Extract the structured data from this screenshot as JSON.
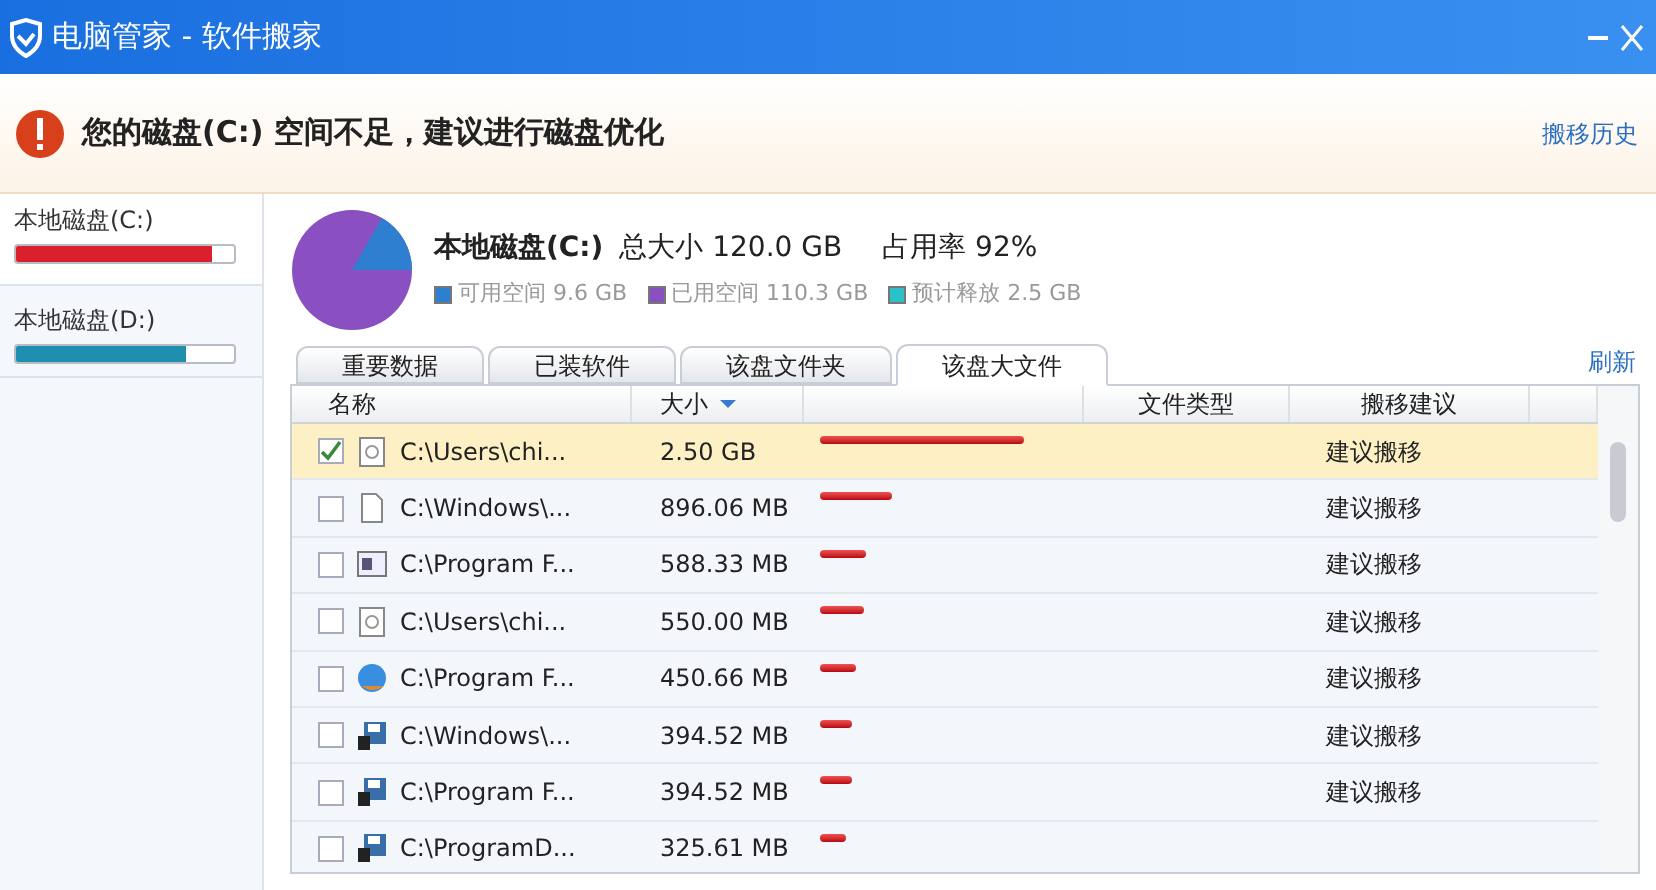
{
  "window": {
    "title": "电脑管家 - 软件搬家"
  },
  "alert": {
    "message": "您的磁盘(C:) 空间不足，建议进行磁盘优化",
    "link": "搬移历史"
  },
  "sidebar": {
    "items": [
      {
        "label": "本地磁盘(C:)",
        "level": 0.9,
        "selected": true,
        "color": "#d9202c"
      },
      {
        "label": "本地磁盘(D:)",
        "level": 0.78,
        "selected": false,
        "color": "#1f8fb0"
      }
    ]
  },
  "disk": {
    "name": "本地磁盘(C:)",
    "total": "总大小 120.0 GB",
    "usage": "占用率 92%",
    "legend": [
      {
        "label": "可用空间 9.6 GB",
        "color": "#2f7fd0"
      },
      {
        "label": "已用空间 110.3 GB",
        "color": "#8a4fc0"
      },
      {
        "label": "预计释放 2.5 GB",
        "color": "#2cc0c8"
      }
    ]
  },
  "tabs": [
    {
      "label": "重要数据",
      "selected": false
    },
    {
      "label": "已装软件",
      "selected": false
    },
    {
      "label": "该盘文件夹",
      "selected": false
    },
    {
      "label": "该盘大文件",
      "selected": true
    }
  ],
  "refresh": "刷新",
  "table": {
    "columns": [
      "名称",
      "大小",
      "文件类型",
      "搬移建议"
    ],
    "rows": [
      {
        "checked": true,
        "kind": "doc",
        "name": "C:\\Users\\chi...",
        "size": "2.50 GB",
        "advice": "建议搬移"
      },
      {
        "checked": false,
        "kind": "blank",
        "name": "C:\\Windows\\...",
        "size": "896.06 MB",
        "advice": "建议搬移"
      },
      {
        "checked": false,
        "kind": "window",
        "name": "C:\\Program F...",
        "size": "588.33 MB",
        "advice": "建议搬移"
      },
      {
        "checked": false,
        "kind": "doc",
        "name": "C:\\Users\\chi...",
        "size": "550.00 MB",
        "advice": "建议搬移"
      },
      {
        "checked": false,
        "kind": "globe",
        "name": "C:\\Program F...",
        "size": "450.66 MB",
        "advice": "建议搬移"
      },
      {
        "checked": false,
        "kind": "disk",
        "name": "C:\\Windows\\...",
        "size": "394.52 MB",
        "advice": "建议搬移"
      },
      {
        "checked": false,
        "kind": "disk",
        "name": "C:\\Program F...",
        "size": "394.52 MB",
        "advice": "建议搬移"
      },
      {
        "checked": false,
        "kind": "disk",
        "name": "C:\\ProgramD...",
        "size": "325.61 MB"
      }
    ]
  }
}
